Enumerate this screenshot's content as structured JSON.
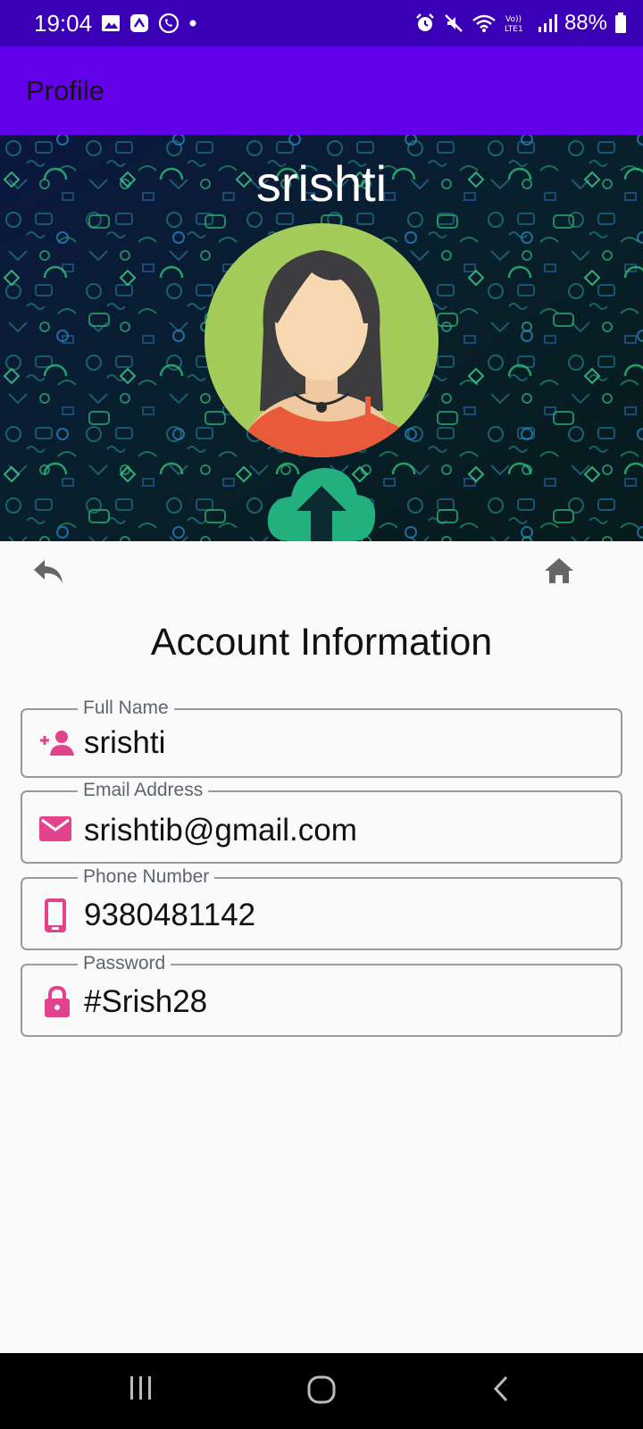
{
  "status_bar": {
    "time": "19:04",
    "battery": "88%",
    "left_icons": [
      "gallery-icon",
      "app-icon",
      "whatsapp-icon",
      "dot-icon"
    ],
    "right_icons": [
      "alarm-icon",
      "mute-icon",
      "wifi-icon",
      "volte-icon",
      "signal-icon",
      "battery-icon"
    ]
  },
  "app_bar": {
    "title": "Profile"
  },
  "header": {
    "user_name": "srishti",
    "avatar": "avatar-woman-icon",
    "upload": "cloud-upload-icon"
  },
  "nav": {
    "back": "reply-arrow-icon",
    "home": "home-icon"
  },
  "section": {
    "title": "Account Information"
  },
  "fields": [
    {
      "label": "Full Name",
      "value": "srishti",
      "icon": "person-add-icon"
    },
    {
      "label": "Email Address",
      "value": "srishtib@gmail.com",
      "icon": "mail-icon"
    },
    {
      "label": "Phone Number",
      "value": "9380481142",
      "icon": "phone-icon"
    },
    {
      "label": "Password",
      "value": "#Srish28",
      "icon": "lock-icon"
    }
  ],
  "colors": {
    "status_bar": "#3a00b5",
    "app_bar": "#6200ea",
    "field_icon": "#e3428c",
    "avatar_bg": "#a4cc5a",
    "upload": "#22b07f"
  },
  "system_nav": [
    "recents-icon",
    "home-circle-icon",
    "back-chevron-icon"
  ]
}
